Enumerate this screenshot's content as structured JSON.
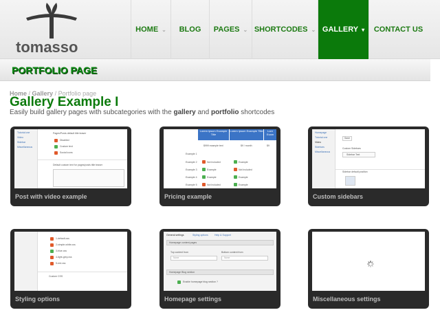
{
  "brand": {
    "name": "tomasso"
  },
  "nav": [
    {
      "label": "HOME",
      "chev": "⌄"
    },
    {
      "label": "BLOG",
      "chev": ""
    },
    {
      "label": "PAGES",
      "chev": "⌄"
    },
    {
      "label": "SHORTCODES",
      "chev": "⌄"
    },
    {
      "label": "GALLERY",
      "chev": "▾"
    },
    {
      "label": "CONTACT US",
      "chev": ""
    }
  ],
  "banner": {
    "title": "PORTFOLIO PAGE"
  },
  "breadcrumb": {
    "home": "Home",
    "sep1": " / ",
    "gallery": "Gallery",
    "sep2": " / ",
    "current": "Portfolio page"
  },
  "page": {
    "title": "Gallery Example I",
    "subtitle_pre": "Easily build gallery pages with subcategories with the ",
    "subtitle_b1": "gallery",
    "subtitle_mid": " and ",
    "subtitle_b2": "portfolio",
    "subtitle_post": " shortcodes"
  },
  "cards": [
    {
      "caption": "Post with video example"
    },
    {
      "caption": "Pricing example"
    },
    {
      "caption": "Custom sidebars"
    },
    {
      "caption": "Styling options"
    },
    {
      "caption": "Homepage settings"
    },
    {
      "caption": "Miscellaneous settings"
    }
  ],
  "mini": {
    "side1": [
      "Tutorial one",
      "Video",
      "Sidebar",
      "Miscellaneous"
    ],
    "c1_head": "Pages/Posts default title teaser",
    "c1_items": [
      "Disabled",
      "Custom text",
      "Social icons"
    ],
    "c1_foot": "Default custom text for pages/posts title teaser",
    "price_titles": [
      "Lorem ipsum Example Title",
      "Lorem ipsum Example Title",
      "Lore Exam"
    ],
    "price_values": [
      "$999 example text",
      "$9 / month",
      "$9"
    ],
    "price_rows": [
      "Example 1",
      "Example 2",
      "Example 3",
      "Example 4",
      "Example 5"
    ],
    "price_cells": [
      "Not Included",
      "Example"
    ],
    "side3": [
      "Homepage",
      "Tutorial one",
      "Video",
      "Sidebars",
      "Miscellaneous"
    ],
    "c3_save": "Save",
    "c3_head": "Custom Sidebars",
    "c3_item": "Sidebar Text",
    "c3_foot": "Sidebar default position",
    "c4_items": [
      "1-default.css",
      "2-simple-white.css",
      "3-blue.css",
      "4-light-grey.css",
      "5-red.css"
    ],
    "c4_foot": "Custom CSS",
    "c5_tabs": [
      "General settings",
      "Styling options",
      "Help & Support"
    ],
    "c5_sec1": "Homepage content pages",
    "c5_lbl1": "Top content from",
    "c5_lbl2": "Bottom content from",
    "c5_none": "None",
    "c5_sec2": "Homepage Blog section",
    "c5_chk": "Enable homepage blog section ?"
  }
}
